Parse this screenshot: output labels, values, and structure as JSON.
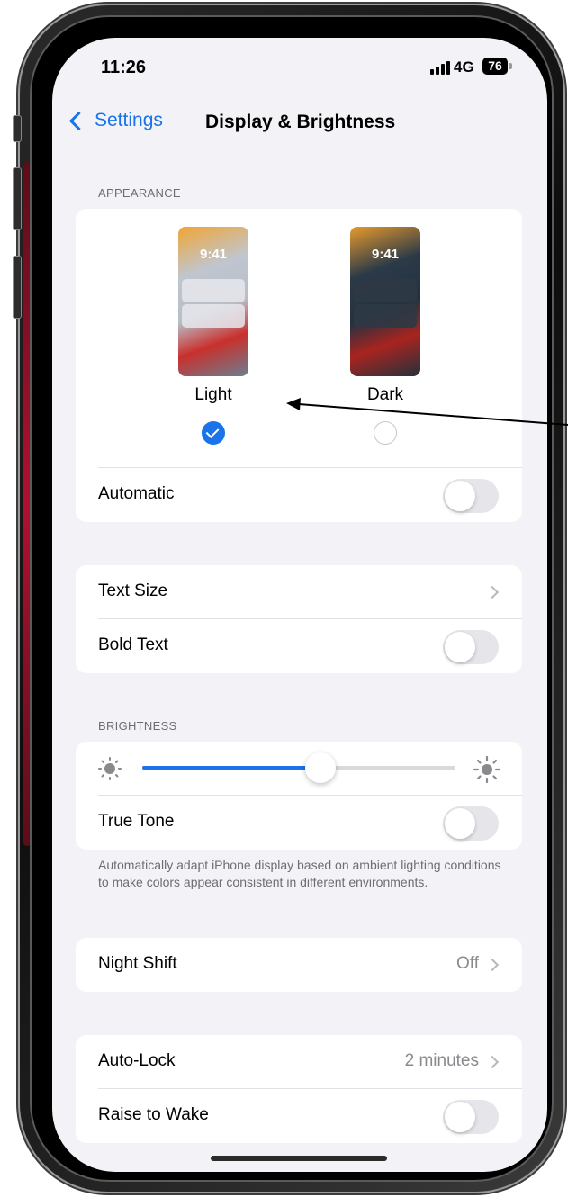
{
  "status_bar": {
    "time": "11:26",
    "network": "4G",
    "battery": "76"
  },
  "nav": {
    "back_label": "Settings",
    "title": "Display & Brightness"
  },
  "appearance": {
    "section_label": "APPEARANCE",
    "light": {
      "label": "Light",
      "preview_time": "9:41",
      "selected": true
    },
    "dark": {
      "label": "Dark",
      "preview_time": "9:41",
      "selected": false
    },
    "automatic_label": "Automatic",
    "automatic_on": false
  },
  "text": {
    "text_size_label": "Text Size",
    "bold_text_label": "Bold Text",
    "bold_text_on": false
  },
  "brightness": {
    "section_label": "BRIGHTNESS",
    "level": 0.57,
    "true_tone_label": "True Tone",
    "true_tone_on": false,
    "footnote": "Automatically adapt iPhone display based on ambient lighting conditions to make colors appear consistent in different environments."
  },
  "night_shift": {
    "label": "Night Shift",
    "value": "Off"
  },
  "lock": {
    "auto_lock_label": "Auto-Lock",
    "auto_lock_value": "2 minutes",
    "raise_to_wake_label": "Raise to Wake",
    "raise_to_wake_on": false
  },
  "colors": {
    "accent": "#1a73e8",
    "background": "#f2f2f7",
    "toggle_off": "#e5e5ea"
  }
}
